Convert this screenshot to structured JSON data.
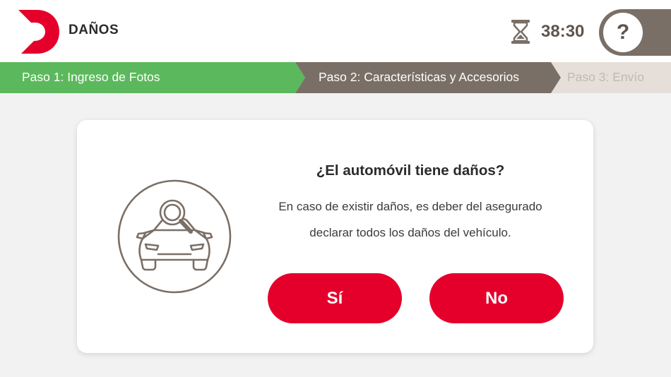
{
  "header": {
    "title": "DAÑOS",
    "timer": "38:30",
    "help_label": "?",
    "brand_color": "#e4002b"
  },
  "steps": [
    {
      "label": "Paso 1: Ingreso de Fotos",
      "status": "completed",
      "color": "#5cb85c"
    },
    {
      "label": "Paso 2: Características y Accesorios",
      "status": "current",
      "color": "#7a6f66"
    },
    {
      "label": "Paso 3: Envío",
      "status": "pending",
      "color": "#e6dfd9"
    }
  ],
  "dialog": {
    "icon": "car-inspection-icon",
    "question": "¿El automóvil tiene daños?",
    "description_line1": "En caso de existir daños, es deber del asegurado",
    "description_line2": "declarar todos los daños del vehículo.",
    "yes_label": "Sí",
    "no_label": "No",
    "button_color": "#e4002b"
  }
}
